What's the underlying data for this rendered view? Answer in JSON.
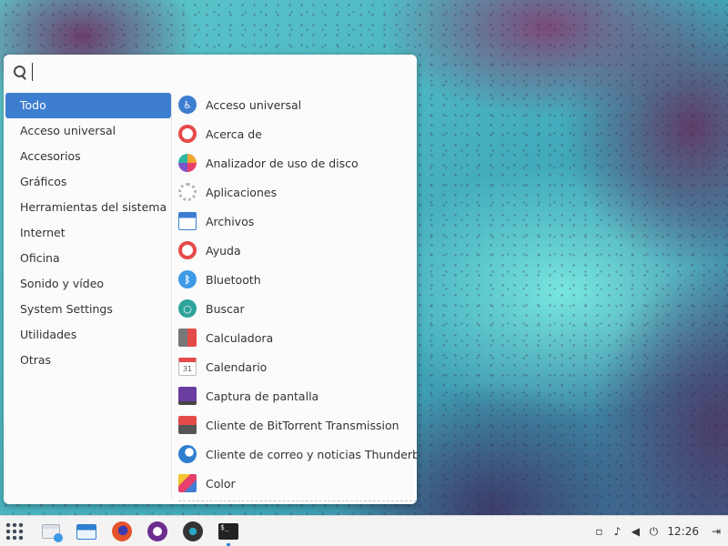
{
  "search": {
    "value": "",
    "placeholder": ""
  },
  "categories": [
    {
      "label": "Todo",
      "active": true
    },
    {
      "label": "Acceso universal"
    },
    {
      "label": "Accesorios"
    },
    {
      "label": "Gráficos"
    },
    {
      "label": "Herramientas del sistema"
    },
    {
      "label": "Internet"
    },
    {
      "label": "Oficina"
    },
    {
      "label": "Sonido y vídeo"
    },
    {
      "label": "System Settings"
    },
    {
      "label": "Utilidades"
    },
    {
      "label": "Otras"
    }
  ],
  "apps": [
    {
      "label": "Acceso universal",
      "icon": "accessibility-icon"
    },
    {
      "label": "Acerca de",
      "icon": "lifebuoy-icon"
    },
    {
      "label": "Analizador de uso de disco",
      "icon": "disk-usage-icon"
    },
    {
      "label": "Aplicaciones",
      "icon": "gear-icon"
    },
    {
      "label": "Archivos",
      "icon": "folder-icon"
    },
    {
      "label": "Ayuda",
      "icon": "lifebuoy-icon"
    },
    {
      "label": "Bluetooth",
      "icon": "bluetooth-icon"
    },
    {
      "label": "Buscar",
      "icon": "search-icon"
    },
    {
      "label": "Calculadora",
      "icon": "calculator-icon"
    },
    {
      "label": "Calendario",
      "icon": "calendar-icon",
      "badge": "31"
    },
    {
      "label": "Captura de pantalla",
      "icon": "screenshot-icon"
    },
    {
      "label": "Cliente de BitTorrent Transmission",
      "icon": "transmission-icon"
    },
    {
      "label": "Cliente de correo y noticias Thunderbird",
      "icon": "thunderbird-icon"
    },
    {
      "label": "Color",
      "icon": "color-icon"
    }
  ],
  "taskbar": {
    "clock": "12:26",
    "launchers": [
      "app-grid-icon",
      "file-manager-icon",
      "files-icon",
      "firefox-icon",
      "media-player-icon",
      "disc-icon",
      "terminal-icon"
    ]
  },
  "colors": {
    "accent": "#3d7ed1",
    "menu_bg": "#fbfbfb",
    "taskbar_bg": "#f3f3f3"
  }
}
